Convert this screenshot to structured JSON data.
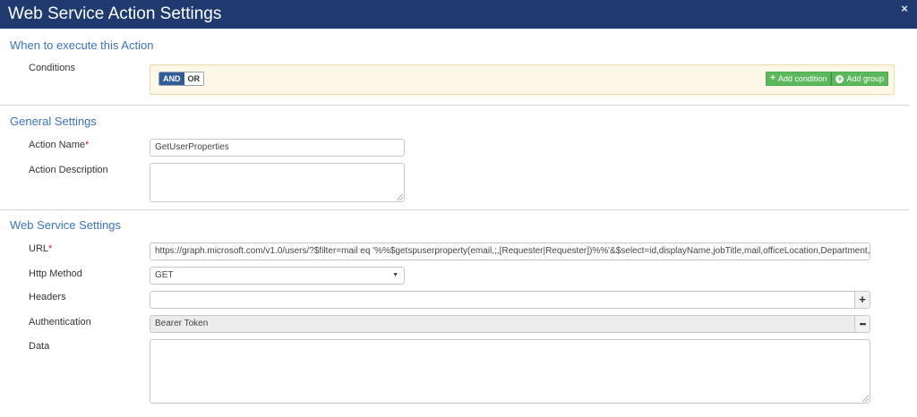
{
  "window": {
    "title": "Web Service Action Settings",
    "close_glyph": "×"
  },
  "when_section": {
    "title": "When to execute this Action",
    "conditions_label": "Conditions",
    "toggle": {
      "and_label": "AND",
      "or_label": "OR",
      "selected": "AND"
    },
    "add_condition_label": "Add condition",
    "add_group_label": "Add group"
  },
  "general_section": {
    "title": "General Settings",
    "action_name_label": "Action Name",
    "action_name_required": "*",
    "action_name_value": "GetUserProperties",
    "action_description_label": "Action Description",
    "action_description_value": ""
  },
  "web_service_section": {
    "title": "Web Service Settings",
    "url_label": "URL",
    "url_required": "*",
    "url_value": "https://graph.microsoft.com/v1.0/users/?$filter=mail eq '%%$getspuserproperty(email,;,[Requester|Requester])%%'&$select=id,displayName,jobTitle,mail,officeLocation,Department,",
    "http_method_label": "Http Method",
    "http_method_value": "GET",
    "headers_label": "Headers",
    "headers_value": "",
    "headers_add_glyph": "+",
    "authentication_label": "Authentication",
    "authentication_value": "Bearer Token",
    "authentication_more_glyph": "•••",
    "data_label": "Data",
    "data_value": ""
  },
  "icons": {
    "close": "close-icon",
    "add_condition": "plus-icon",
    "add_group": "circle-plus-icon",
    "select_caret": "caret-down-icon",
    "headers_add": "plus-icon",
    "auth_more": "ellipsis-icon"
  },
  "colors": {
    "titlebar": "#1e3a6e",
    "section_title": "#3a74c0",
    "required": "#d9232d",
    "conditions_bg": "#fcf7e6",
    "button_green": "#5cb85c",
    "toggle_selected": "#2e5e99"
  }
}
